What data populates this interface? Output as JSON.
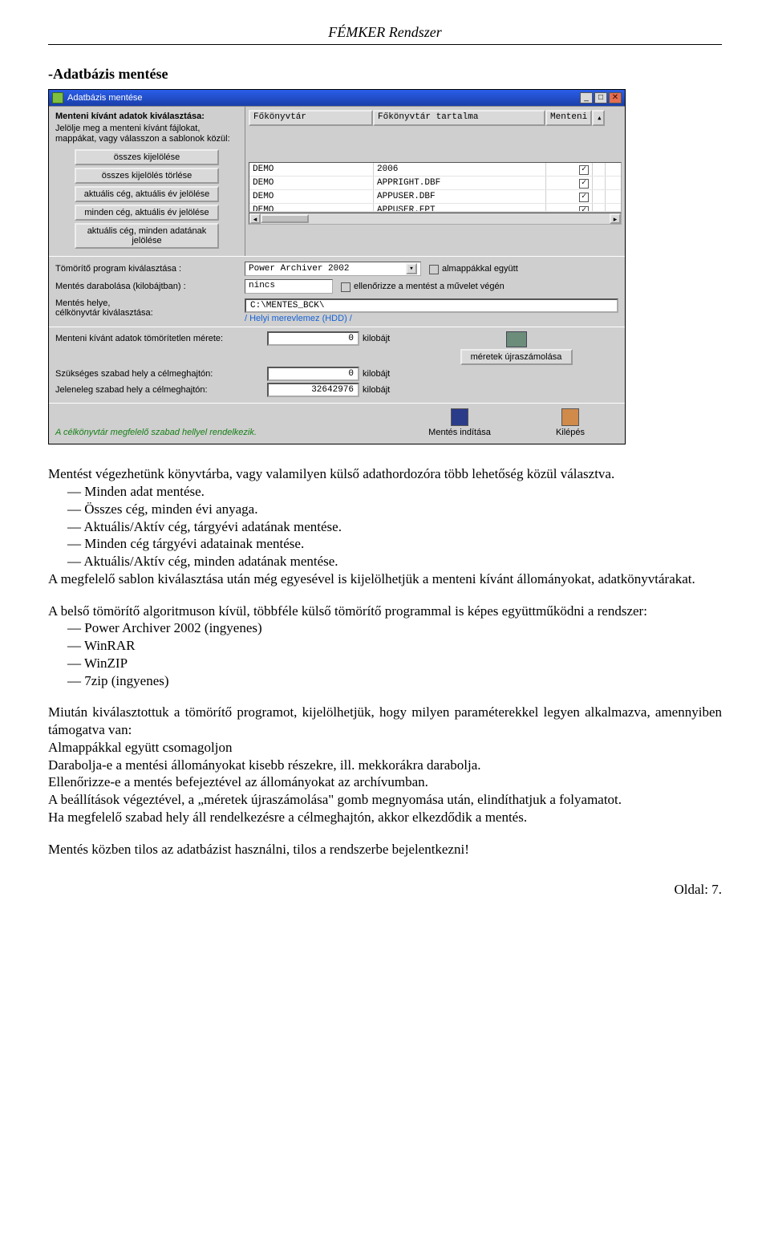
{
  "doc": {
    "header": "FÉMKER Rendszer",
    "section_heading": "-Adatbázis mentése",
    "footer": "Oldal: 7."
  },
  "window": {
    "title": "Adatbázis mentése",
    "left": {
      "label": "Menteni kívánt adatok kiválasztása:",
      "desc": "Jelölje meg a menteni kívánt fájlokat, mappákat, vagy válasszon a sablonok közül:",
      "buttons": {
        "all_select": "összes kijelölése",
        "all_clear": "összes kijelölés törlése",
        "curr_year": "aktuális cég, aktuális év jelölése",
        "all_firm_year": "minden cég, aktuális év jelölése",
        "curr_all": "aktuális cég, minden adatának jelölése"
      }
    },
    "table": {
      "headers": {
        "c1": "Főkönyvtár",
        "c2": "Főkönyvtár tartalma",
        "c3": "Menteni"
      },
      "rows": [
        {
          "c1": "DEMO",
          "c2": "2006",
          "checked": true
        },
        {
          "c1": "DEMO",
          "c2": "APPRIGHT.DBF",
          "checked": true
        },
        {
          "c1": "DEMO",
          "c2": "APPUSER.DBF",
          "checked": true
        },
        {
          "c1": "DEMO",
          "c2": "APPUSER.FPT",
          "checked": true
        }
      ]
    },
    "compress": {
      "label": "Tömörítő program kiválasztása :",
      "value": "Power Archiver 2002",
      "subfolders_label": "almappákkal együtt"
    },
    "split": {
      "label": "Mentés darabolása (kilobájtban) :",
      "value": "nincs",
      "verify_label": "ellenőrizze a mentést a művelet végén"
    },
    "dest": {
      "label": "Mentés helye,\ncélkönyvtár kiválasztása:",
      "path": "C:\\MENTES_BCK\\",
      "drive": "/ Helyi merevlemez (HDD) /"
    },
    "stats": {
      "unit": "kilobájt",
      "lines": [
        {
          "label": "Menteni kívánt adatok tömörítetlen mérete:",
          "value": "0"
        },
        {
          "label": "Szükséges szabad hely a célmeghajtón:",
          "value": "0"
        },
        {
          "label": "Jeleneleg szabad hely a célmeghajtón:",
          "value": "32642976"
        }
      ],
      "recalc": "méretek újraszámolása"
    },
    "ok_message": "A célkönyvtár megfelelő szabad hellyel rendelkezik.",
    "actions": {
      "start": "Mentés indítása",
      "exit": "Kilépés"
    }
  },
  "body": {
    "p1": "Mentést végezhetünk könyvtárba, vagy valamilyen külső adathordozóra több lehetőség közül választva.",
    "li1": "Minden adat mentése.",
    "li2": "Összes cég, minden évi anyaga.",
    "li3": "Aktuális/Aktív cég, tárgyévi adatának mentése.",
    "li4": "Minden cég tárgyévi adatainak mentése.",
    "li5": "Aktuális/Aktív cég, minden adatának mentése.",
    "p2": "A megfelelő sablon kiválasztása után még egyesével is kijelölhetjük a menteni kívánt állományokat, adatkönyvtárakat.",
    "p3": "A belső tömörítő algoritmuson kívül, többféle külső tömörítő programmal is képes együttműködni a rendszer:",
    "tool1": "Power Archiver 2002 (ingyenes)",
    "tool2": "WinRAR",
    "tool3": "WinZIP",
    "tool4": "7zip (ingyenes)",
    "p4": "Miután kiválasztottuk a tömörítő programot, kijelölhetjük, hogy milyen paraméterekkel legyen alkalmazva, amennyiben támogatva van:",
    "p4a": "Almappákkal együtt csomagoljon",
    "p4b": "Darabolja-e a mentési állományokat kisebb részekre, ill. mekkorákra darabolja.",
    "p4c": "Ellenőrizze-e a mentés befejeztével az állományokat az archívumban.",
    "p4d": "A beállítások végeztével, a „méretek újraszámolása\" gomb megnyomása után, elindíthatjuk a folyamatot.",
    "p4e": "Ha megfelelő szabad hely áll rendelkezésre a célmeghajtón, akkor elkezdődik a mentés.",
    "p5": "Mentés közben tilos az adatbázist használni, tilos a rendszerbe bejelentkezni!"
  }
}
